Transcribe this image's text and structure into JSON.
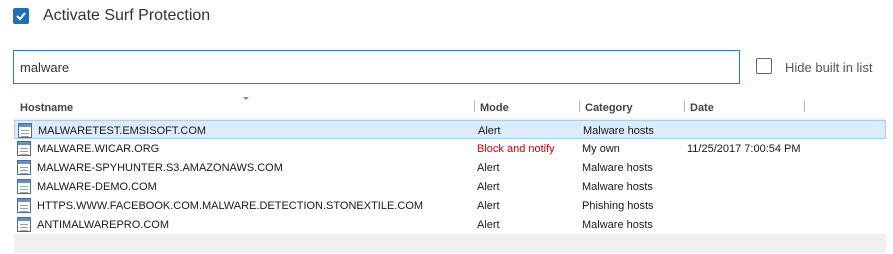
{
  "surf_protection": {
    "label": "Activate Surf Protection",
    "checked": true
  },
  "search": {
    "value": "malware"
  },
  "hide_builtin": {
    "label": "Hide built in list",
    "checked": false
  },
  "table": {
    "columns": [
      "Hostname",
      "Mode",
      "Category",
      "Date"
    ],
    "rows": [
      {
        "hostname": "MALWARETEST.EMSISOFT.COM",
        "mode": "Alert",
        "category": "Malware hosts",
        "date": ""
      },
      {
        "hostname": "MALWARE.WICAR.ORG",
        "mode": "Block and notify",
        "category": "My own",
        "date": "11/25/2017 7:00:54 PM"
      },
      {
        "hostname": "MALWARE-SPYHUNTER.S3.AMAZONAWS.COM",
        "mode": "Alert",
        "category": "Malware hosts",
        "date": ""
      },
      {
        "hostname": "MALWARE-DEMO.COM",
        "mode": "Alert",
        "category": "Malware hosts",
        "date": ""
      },
      {
        "hostname": "HTTPS.WWW.FACEBOOK.COM.MALWARE.DETECTION.STONEXTILE.COM",
        "mode": "Alert",
        "category": "Phishing hosts",
        "date": ""
      },
      {
        "hostname": "ANTIMALWAREPRO.COM",
        "mode": "Alert",
        "category": "Malware hosts",
        "date": ""
      }
    ],
    "selected_row": 0
  },
  "colors": {
    "accent": "#1e6fb5",
    "block_mode": "#d10000",
    "selection": "#dcecfb"
  }
}
